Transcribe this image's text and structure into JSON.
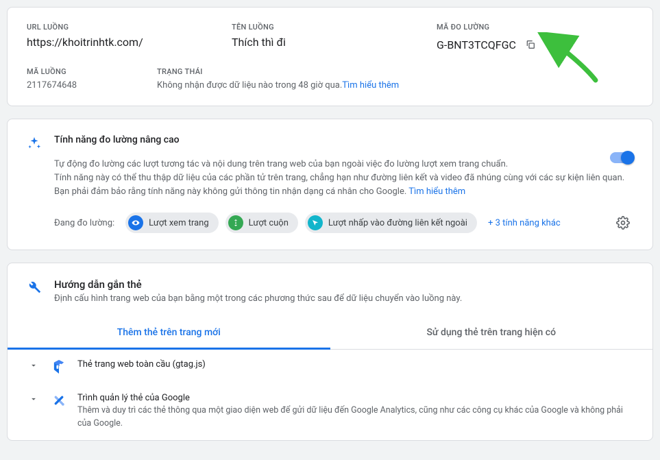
{
  "stream": {
    "url_label": "URL LUỒNG",
    "url": "https://khoitrinhtk.com/",
    "name_label": "TÊN LUỒNG",
    "name": "Thích thì đi",
    "meas_id_label": "MÃ ĐO LƯỜNG",
    "meas_id": "G-BNT3TCQFGC",
    "id_label": "MÃ LUỒNG",
    "id": "2117674648",
    "status_label": "TRẠNG THÁI",
    "status_text": "Không nhận được dữ liệu nào trong 48 giờ qua.",
    "status_link": "Tìm hiểu thêm"
  },
  "enhanced": {
    "title": "Tính năng đo lường nâng cao",
    "body": "Tự động đo lường các lượt tương tác và nội dung trên trang web của bạn ngoài việc đo lường lượt xem trang chuẩn.\nTính năng này có thể thu thập dữ liệu của các phần tử trên trang, chẳng hạn như đường liên kết và video đã nhúng cùng với các sự kiện liên quan. Bạn phải đảm bảo rằng tính năng này không gửi thông tin nhận dạng cá nhân cho Google.",
    "learn_more": "Tìm hiểu thêm",
    "measuring_lead": "Đang đo lường:",
    "pill1": "Lượt xem trang",
    "pill2": "Lượt cuộn",
    "pill3": "Lượt nhấp vào đường liên kết ngoài",
    "more": "+ 3 tính năng khác",
    "toggle_on": true
  },
  "tagging": {
    "title": "Hướng dẫn gắn thẻ",
    "subtitle": "Định cấu hình trang web của bạn bằng một trong các phương thức sau để dữ liệu chuyển vào luồng này.",
    "tab_new": "Thêm thẻ trên trang mới",
    "tab_existing": "Sử dụng thẻ trên trang hiện có",
    "gtag_title": "Thẻ trang web toàn cầu (gtag.js)",
    "gtm_title": "Trình quản lý thẻ của Google",
    "gtm_desc": "Thêm và duy trì các thẻ thông qua một giao diện web để gửi dữ liệu đến Google Analytics, cũng như các công cụ khác của Google và không phải của Google."
  }
}
